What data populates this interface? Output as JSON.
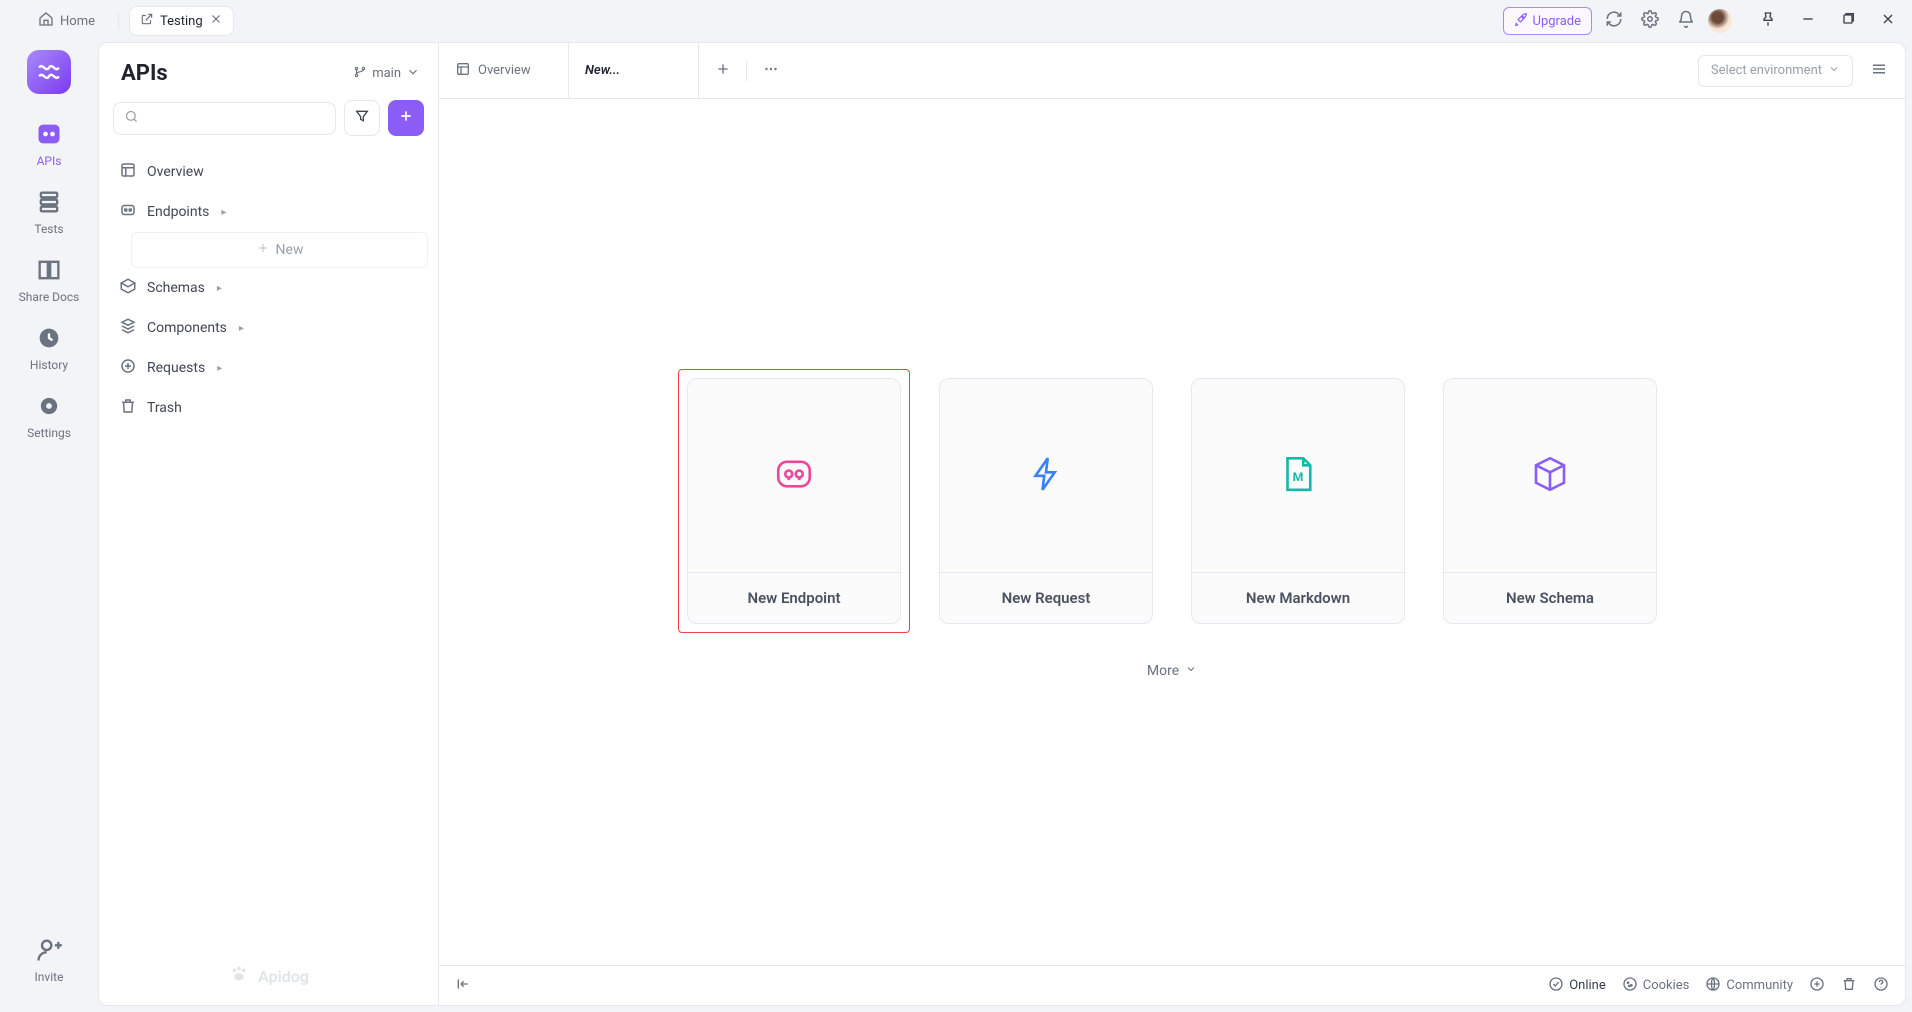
{
  "topbar": {
    "home_label": "Home",
    "tab_label": "Testing",
    "upgrade_label": "Upgrade"
  },
  "rail": {
    "apis": "APIs",
    "tests": "Tests",
    "share_docs": "Share Docs",
    "history": "History",
    "settings": "Settings",
    "invite": "Invite"
  },
  "sidebar": {
    "title": "APIs",
    "branch": "main",
    "search_placeholder": "",
    "items": {
      "overview": "Overview",
      "endpoints": "Endpoints",
      "new_placeholder": "New",
      "schemas": "Schemas",
      "components": "Components",
      "requests": "Requests",
      "trash": "Trash"
    },
    "brand": "Apidog"
  },
  "main": {
    "tabs": {
      "overview": "Overview",
      "new": "New..."
    },
    "env_placeholder": "Select environment",
    "cards": {
      "endpoint": "New Endpoint",
      "request": "New Request",
      "markdown": "New Markdown",
      "schema": "New Schema"
    },
    "more": "More"
  },
  "footer": {
    "online": "Online",
    "cookies": "Cookies",
    "community": "Community"
  }
}
